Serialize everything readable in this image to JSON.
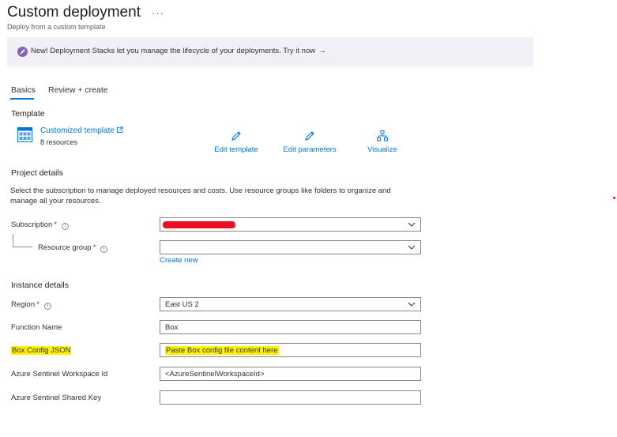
{
  "header": {
    "title": "Custom deployment",
    "more": "···",
    "subtitle": "Deploy from a custom template"
  },
  "banner": {
    "text": "New! Deployment Stacks let you manage the lifecycle of your deployments. Try it now",
    "arrow": "→",
    "accent": "#8764b8"
  },
  "tabs": [
    {
      "label": "Basics",
      "active": true
    },
    {
      "label": "Review + create",
      "active": false
    }
  ],
  "template": {
    "section_title": "Template",
    "link_label": "Customized template",
    "resource_count": "8 resources",
    "actions": [
      {
        "label": "Edit template",
        "icon": "pencil-icon"
      },
      {
        "label": "Edit parameters",
        "icon": "pencil-icon"
      },
      {
        "label": "Visualize",
        "icon": "hierarchy-icon"
      }
    ]
  },
  "project": {
    "section_title": "Project details",
    "description": "Select the subscription to manage deployed resources and costs. Use resource groups like folders to organize and manage all your resources.",
    "subscription_label": "Subscription",
    "subscription_value": "",
    "resource_group_label": "Resource group",
    "resource_group_value": "",
    "create_new": "Create new"
  },
  "instance": {
    "section_title": "Instance details",
    "region_label": "Region",
    "region_value": "East US 2",
    "function_name_label": "Function Name",
    "function_name_value": "Box",
    "box_config_label": "Box Config JSON",
    "box_config_value": "Paste Box config file content here",
    "workspace_id_label": "Azure Sentinel Workspace Id",
    "workspace_id_value": "<AzureSentinelWorkspaceId>",
    "shared_key_label": "Azure Sentinel Shared Key",
    "shared_key_value": ""
  },
  "colors": {
    "link": "#0078d4",
    "required": "#a4262c",
    "highlight": "#fff200",
    "banner_bg": "#f3eff6"
  }
}
